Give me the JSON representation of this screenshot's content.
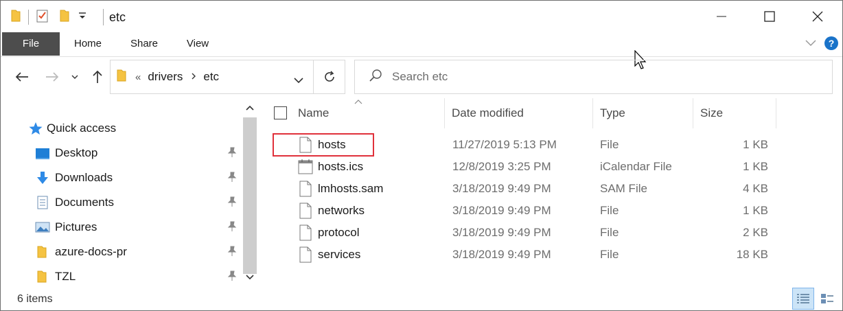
{
  "window": {
    "title": "etc"
  },
  "ribbon": {
    "tabs": [
      "File",
      "Home",
      "Share",
      "View"
    ]
  },
  "address": {
    "overflow": "«",
    "crumbs": [
      "drivers",
      "etc"
    ]
  },
  "search": {
    "placeholder": "Search etc"
  },
  "nav": {
    "items": [
      {
        "label": "Quick access",
        "icon": "star-icon"
      },
      {
        "label": "Desktop",
        "icon": "desktop-icon"
      },
      {
        "label": "Downloads",
        "icon": "download-arrow-icon"
      },
      {
        "label": "Documents",
        "icon": "documents-icon"
      },
      {
        "label": "Pictures",
        "icon": "pictures-icon"
      },
      {
        "label": "azure-docs-pr",
        "icon": "folder-icon"
      },
      {
        "label": "TZL",
        "icon": "folder-icon"
      }
    ]
  },
  "columns": {
    "name": "Name",
    "date": "Date modified",
    "type": "Type",
    "size": "Size"
  },
  "files": [
    {
      "name": "hosts",
      "date": "11/27/2019 5:13 PM",
      "type": "File",
      "size": "1 KB",
      "icon": "blank-file-icon"
    },
    {
      "name": "hosts.ics",
      "date": "12/8/2019 3:25 PM",
      "type": "iCalendar File",
      "size": "1 KB",
      "icon": "calendar-file-icon"
    },
    {
      "name": "lmhosts.sam",
      "date": "3/18/2019 9:49 PM",
      "type": "SAM File",
      "size": "4 KB",
      "icon": "blank-file-icon"
    },
    {
      "name": "networks",
      "date": "3/18/2019 9:49 PM",
      "type": "File",
      "size": "1 KB",
      "icon": "blank-file-icon"
    },
    {
      "name": "protocol",
      "date": "3/18/2019 9:49 PM",
      "type": "File",
      "size": "2 KB",
      "icon": "blank-file-icon"
    },
    {
      "name": "services",
      "date": "3/18/2019 9:49 PM",
      "type": "File",
      "size": "18 KB",
      "icon": "blank-file-icon"
    }
  ],
  "status": {
    "count": "6 items"
  },
  "colors": {
    "file_tab": "#4d4d4d",
    "highlight": "#e0303a",
    "accent": "#1a73c9",
    "folder": "#f5c342"
  }
}
